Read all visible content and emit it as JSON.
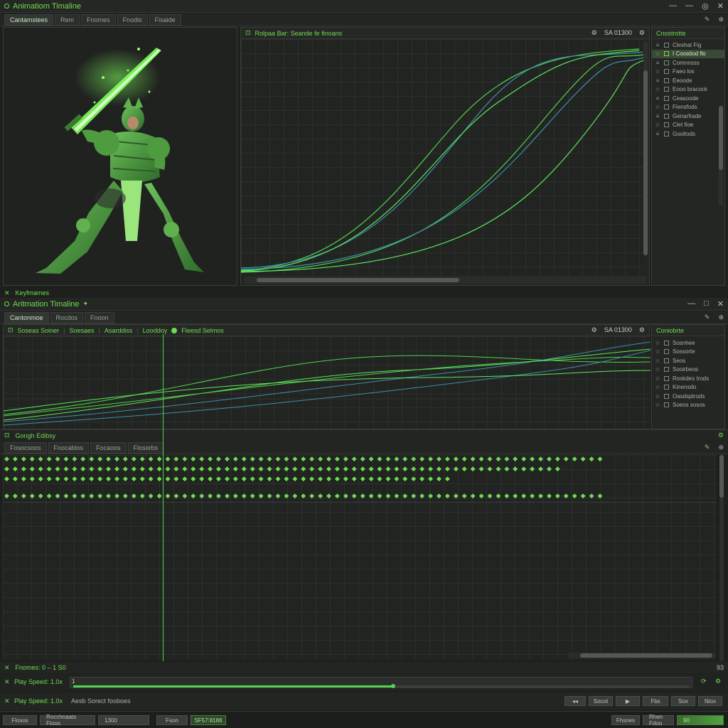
{
  "top_window": {
    "title": "Animatiom Timaline",
    "controls": [
      "—",
      "—",
      "◎",
      "✕"
    ],
    "tabs": [
      "Cantamstees",
      "Rem",
      "Fnomes",
      "Fnodis",
      "Fisaide"
    ],
    "graph_header": "Rolpaa Bar: Seande fe finoans",
    "graph_header_right": "SA 01300",
    "tree_title": "Cnostrotte",
    "tree_items": [
      {
        "label": "Cleshat Fig",
        "selected": false
      },
      {
        "label": "I Coostiod flo",
        "selected": true
      },
      {
        "label": "Comnnsss",
        "selected": false
      },
      {
        "label": "Faeo los",
        "selected": false
      },
      {
        "label": "Eeoode",
        "selected": false
      },
      {
        "label": "Eooo bracock",
        "selected": false
      },
      {
        "label": "Ceasoode",
        "selected": false
      },
      {
        "label": "Fiensfods",
        "selected": false
      },
      {
        "label": "Genarfrade",
        "selected": false
      },
      {
        "label": "Clet fioe",
        "selected": false
      },
      {
        "label": "Gooltods",
        "selected": false
      }
    ]
  },
  "keyframes_label": "Keyfmames",
  "mid_window": {
    "title": "Aritmation Timaline",
    "controls": [
      "—",
      "□",
      "✕"
    ],
    "tabs": [
      "Cantonmoe",
      "Rocdos",
      "Fnoon"
    ],
    "curve_tabs": [
      "Soseas Soiner",
      "Soesaes",
      "Asarddiss",
      "Looddoy",
      "Fleesd Selmos"
    ],
    "curve_header_right": "SA 01300",
    "tree_title": "Coniobrte",
    "tree_items": [
      "Sosnhee",
      "Sossorte",
      "Seos",
      "Sooirbeos",
      "Roskdes trods",
      "Kinensdo",
      "Oasdsptrods",
      "Soeos sosos"
    ]
  },
  "graph_editor": {
    "title": "Gongh Edibsy",
    "tabs": [
      "Fosocsoos",
      "Fnocablos",
      "Focaoos",
      "Flosorbs"
    ]
  },
  "status": {
    "frames": "Fnomes: 0 – 1 S0",
    "frames_right": "93",
    "play_speed_1": "Play Speed: 1.0x",
    "play_speed_1_mark": "1",
    "play_speed_2": "Play Speed: 1.0x",
    "play_speed_2_note": "Aesb Sorect fooboes",
    "progress": 0.52,
    "right_buttons": [
      "◂◂",
      "Socot",
      "▶",
      "Fbs",
      "Sox",
      "Niox"
    ]
  },
  "bottom_bar": {
    "items": [
      "Flosos",
      "Rocchnaats Ftoos",
      "1300",
      "Fson",
      "SF57:8186"
    ],
    "right_items": [
      "Fhsnes",
      "Rhen Fdoo",
      "90"
    ]
  }
}
